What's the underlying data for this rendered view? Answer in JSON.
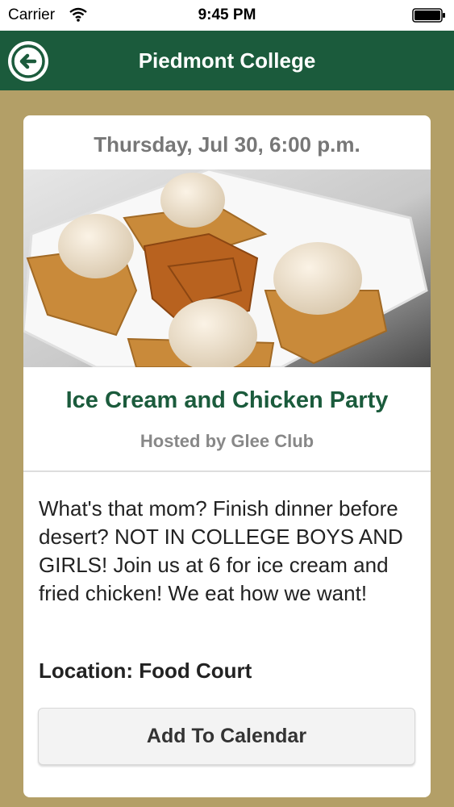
{
  "status_bar": {
    "carrier": "Carrier",
    "time": "9:45 PM"
  },
  "nav": {
    "title": "Piedmont College",
    "back_icon": "back-arrow-icon"
  },
  "event": {
    "date": "Thursday, Jul 30, 6:00 p.m.",
    "title": "Ice Cream and Chicken Party",
    "host": "Hosted by Glee Club",
    "description": "What's that mom? Finish dinner before desert? NOT IN COLLEGE BOYS AND GIRLS! Join us at 6 for ice cream and fried chicken! We eat how we want!",
    "location": "Location: Food Court",
    "add_to_calendar_label": "Add To Calendar"
  },
  "colors": {
    "brand_green": "#1b5b3c",
    "background_gold": "#b39f67",
    "card": "#ffffff"
  }
}
